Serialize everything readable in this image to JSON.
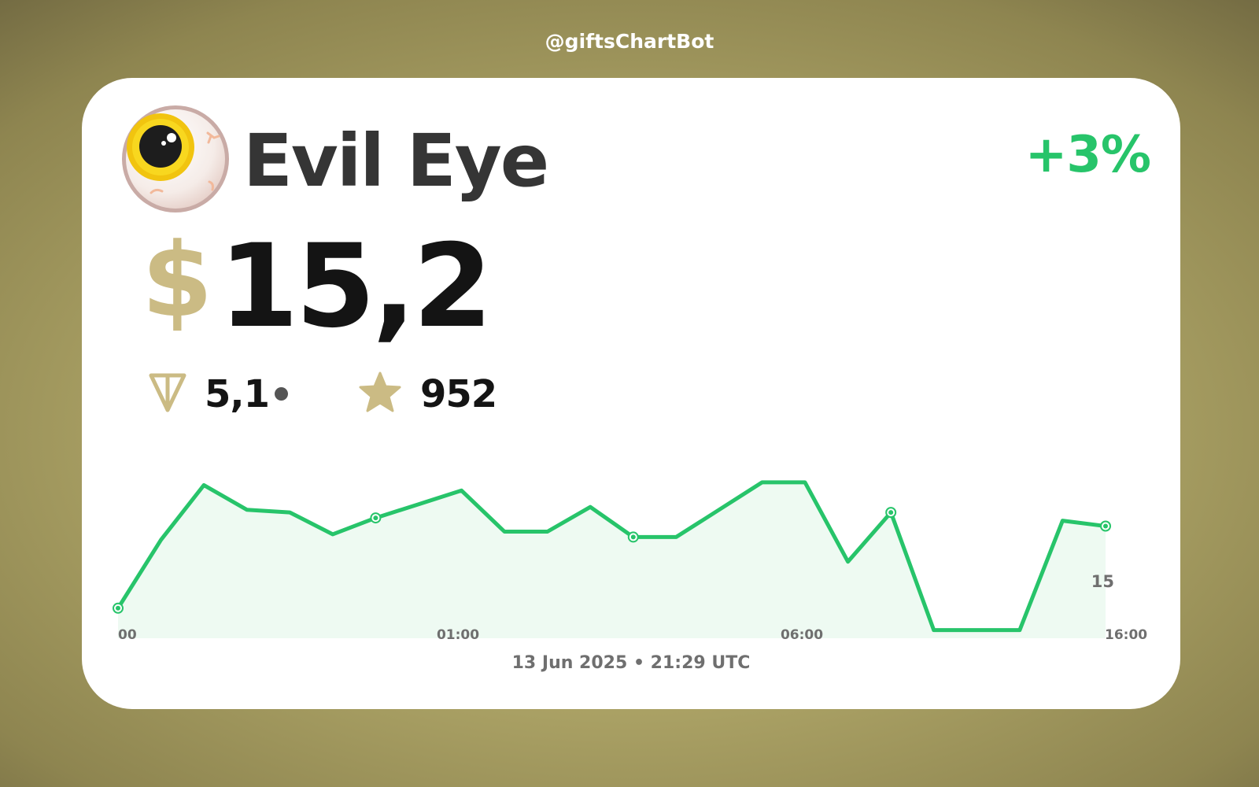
{
  "header": {
    "bot_handle": "@giftsChartBot"
  },
  "gift": {
    "name": "Evil Eye",
    "change": "+3%",
    "price_currency": "$",
    "price_usd": "15,2",
    "price_ton": "5,1",
    "price_stars": "952",
    "timestamp": "13 Jun 2025 • 21:29 UTC"
  },
  "icons": {
    "avatar": "evil-eye-gift-icon",
    "ton": "ton-icon",
    "stars": "star-icon"
  },
  "colors": {
    "accent_gold": "#cbbb84",
    "positive": "#27c46a",
    "background": "#aca366"
  },
  "chart_data": {
    "type": "area",
    "title": "",
    "x_tick_labels": [
      "00",
      "01:00",
      "06:00",
      "16:00"
    ],
    "y_tick_labels": [
      "15"
    ],
    "series": [
      {
        "values": [
          14.0,
          16.5,
          18.5,
          17.6,
          17.5,
          16.7,
          17.3,
          17.8,
          18.3,
          16.8,
          16.8,
          17.7,
          16.6,
          16.6,
          17.6,
          18.6,
          18.6,
          15.7,
          17.5,
          13.2,
          13.2,
          13.2,
          17.2,
          17.0
        ],
        "markers": [
          0,
          6,
          12,
          18,
          23
        ]
      }
    ],
    "ylim": [
      12.9,
      19.0
    ],
    "grid": false,
    "legend": "none"
  }
}
